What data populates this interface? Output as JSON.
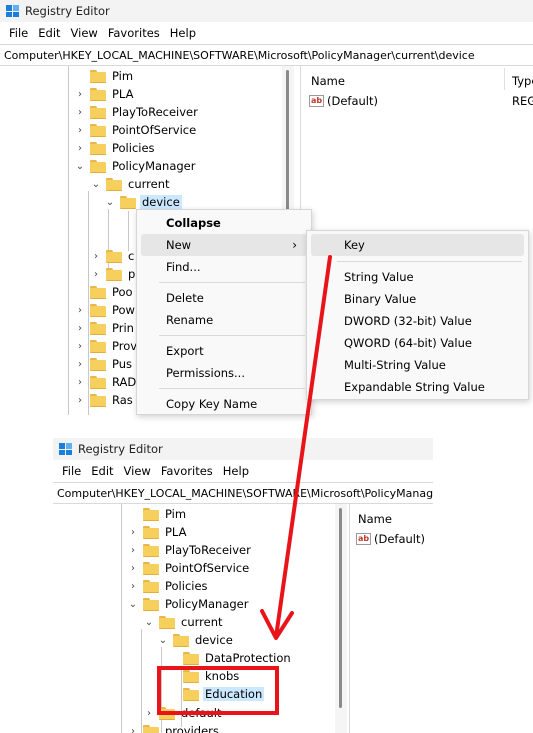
{
  "app_title": "Registry Editor",
  "menu": [
    "File",
    "Edit",
    "View",
    "Favorites",
    "Help"
  ],
  "top": {
    "address": "Computer\\HKEY_LOCAL_MACHINE\\SOFTWARE\\Microsoft\\PolicyManager\\current\\device",
    "tree": [
      "Pim",
      "PLA",
      "PlayToReceiver",
      "PointOfService",
      "Policies",
      "PolicyManager",
      "current",
      "device"
    ],
    "tree_partial": [
      "c",
      "p",
      "Poo",
      "Pow",
      "Prin",
      "Prov",
      "Pus",
      "RAD",
      "Ras"
    ],
    "columns": {
      "name": "Name",
      "type": "Type"
    },
    "value_name": "(Default)",
    "value_type": "REG_"
  },
  "context_menu": {
    "items": [
      "Collapse",
      "New",
      "Find...",
      "Delete",
      "Rename",
      "Export",
      "Permissions...",
      "Copy Key Name"
    ]
  },
  "submenu": {
    "items": [
      "Key",
      "String Value",
      "Binary Value",
      "DWORD (32-bit) Value",
      "QWORD (64-bit) Value",
      "Multi-String Value",
      "Expandable String Value"
    ]
  },
  "bottom": {
    "address": "Computer\\HKEY_LOCAL_MACHINE\\SOFTWARE\\Microsoft\\PolicyManag",
    "tree": [
      "Pim",
      "PLA",
      "PlayToReceiver",
      "PointOfService",
      "Policies",
      "PolicyManager",
      "current",
      "device",
      "DataProtection",
      "knobs",
      "Education",
      "default",
      "providers"
    ],
    "columns": {
      "name": "Name"
    },
    "value_name": "(Default)"
  },
  "icon_value": "ab",
  "colors": {
    "annotation_red": "#e8141a",
    "selection": "#cce8ff",
    "folder": "#f6cf5d"
  }
}
